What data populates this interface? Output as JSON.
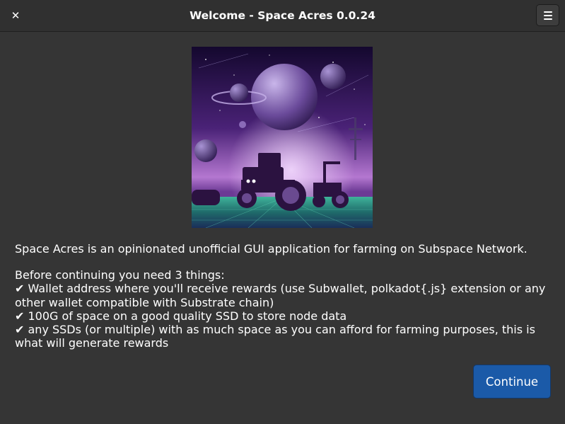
{
  "window": {
    "title": "Welcome - Space Acres 0.0.24",
    "close_glyph": "✕"
  },
  "hero_image": {
    "icon": "space-farm-illustration",
    "colors": {
      "sky_top": "#1a0a3a",
      "sky_mid": "#5a2a8a",
      "glow": "#e0b8f0",
      "ground": "#2a8a7a",
      "tractor": "#3a1a4a"
    }
  },
  "content": {
    "intro": "Space Acres is an opinionated unofficial GUI application for farming on Subspace Network.",
    "requirements_heading": "Before continuing you need 3 things:",
    "requirements": [
      "✔ Wallet address where you'll receive rewards (use Subwallet, polkadot{.js} extension or any other wallet compatible with Substrate chain)",
      "✔ 100G of space on a good quality SSD to store node data",
      "✔ any SSDs (or multiple) with as much space as you can afford for farming purposes, this is what will generate rewards"
    ]
  },
  "actions": {
    "continue_label": "Continue"
  },
  "colors": {
    "background": "#353535",
    "titlebar": "#303030",
    "accent": "#1b5aa8"
  }
}
